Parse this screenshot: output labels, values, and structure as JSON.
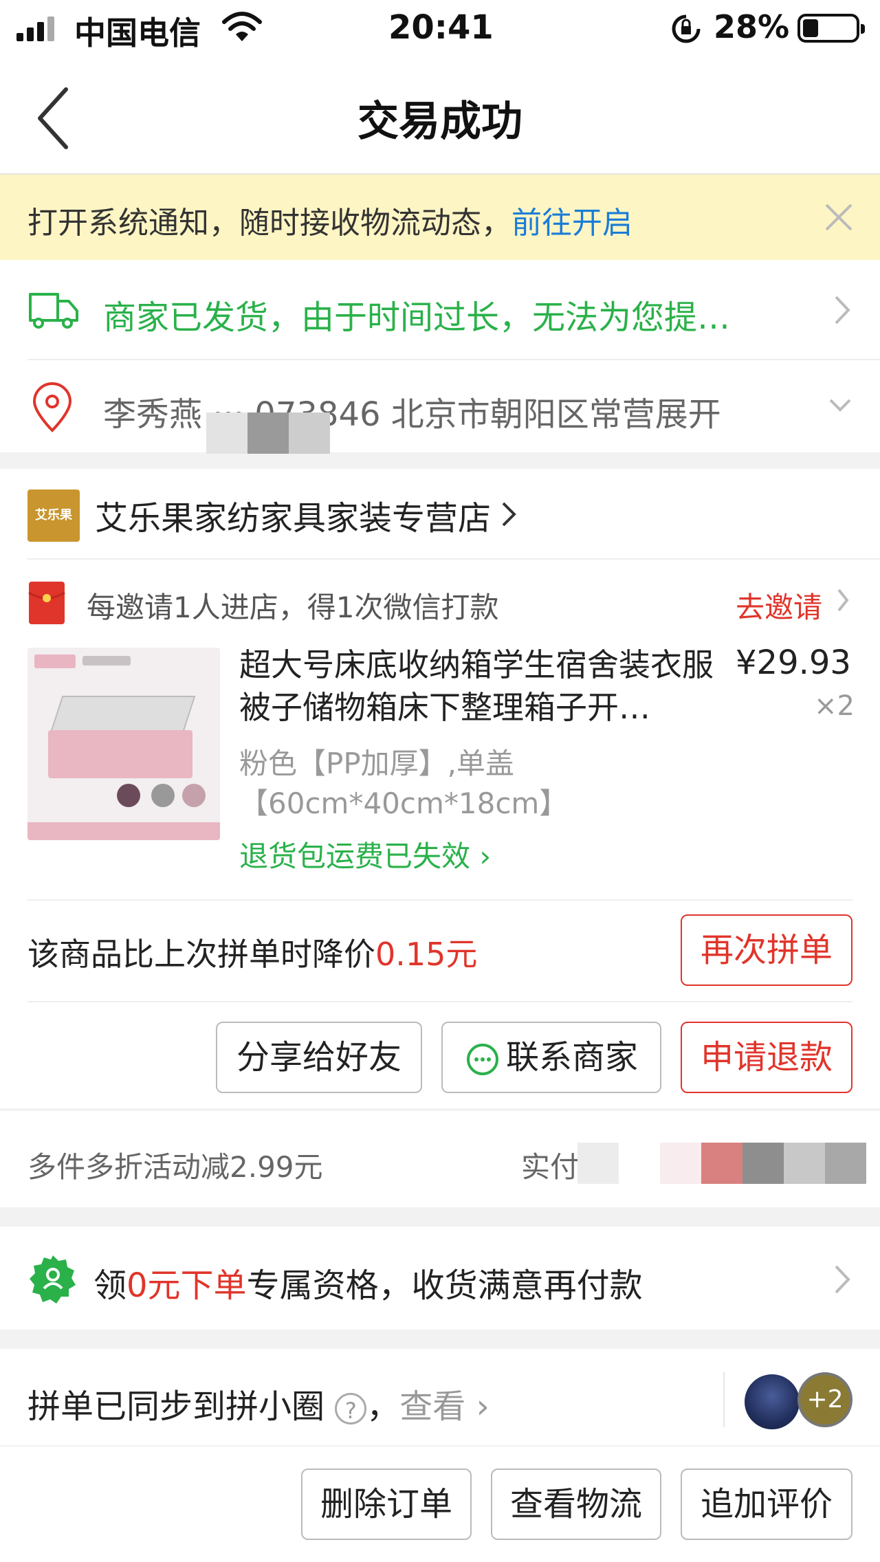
{
  "status_bar": {
    "carrier": "中国电信",
    "time": "20:41",
    "battery": "28%"
  },
  "nav": {
    "title": "交易成功"
  },
  "notice": {
    "text": "打开系统通知，随时接收物流动态，",
    "link": "前往开启"
  },
  "logistics": {
    "status": "商家已发货，由于时间过长，无法为您提…"
  },
  "address": {
    "text": "李秀燕 ··· 073846 北京市朝阳区常营展开"
  },
  "store": {
    "badge": "艾乐果",
    "name": "艾乐果家纺家具家装专营店"
  },
  "invite": {
    "text": "每邀请1人进店，得1次微信打款",
    "action": "去邀请"
  },
  "product": {
    "title": "超大号床底收纳箱学生宿舍装衣服被子储物箱床下整理箱子开…",
    "price": "¥29.93",
    "quantity": "×2",
    "spec_line1": "粉色【PP加厚】,单盖",
    "spec_line2": "【60cm*40cm*18cm】",
    "refund_tip": "退货包运费已失效"
  },
  "price_drop": {
    "prefix": "该商品比上次拼单时降价",
    "amount": "0.15元",
    "button": "再次拼单"
  },
  "actions": {
    "share": "分享给好友",
    "contact": "联系商家",
    "refund": "申请退款"
  },
  "discount": {
    "text": "多件多折活动减2.99元",
    "paid_label": "实付"
  },
  "zero_order": {
    "prefix": "领",
    "highlight": "0元下单",
    "suffix": "专属资格，收货满意再付款"
  },
  "group": {
    "text": "拼单已同步到拼小圈",
    "view": "查看",
    "extra": "+2"
  },
  "bottom": {
    "delete": "删除订单",
    "logistics": "查看物流",
    "review": "追加评价"
  },
  "colors": {
    "accent_red": "#e0352b",
    "green": "#2ab14a",
    "link_blue": "#1a7cd8",
    "notice_bg": "#fdf5c4"
  }
}
